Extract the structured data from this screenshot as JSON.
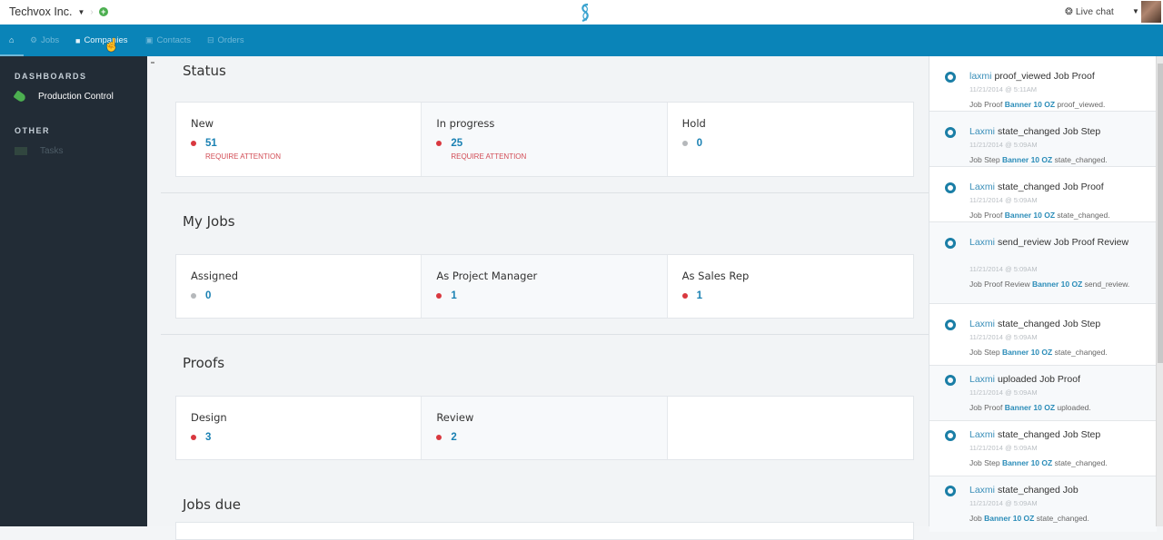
{
  "topbar": {
    "company": "Techvox Inc.",
    "live_chat": "Live chat"
  },
  "nav": {
    "items": [
      {
        "label": "Jobs",
        "icon": "gears-icon"
      },
      {
        "label": "Companies",
        "icon": "building-icon"
      },
      {
        "label": "Contacts",
        "icon": "contacts-icon"
      },
      {
        "label": "Orders",
        "icon": "inbox-icon"
      }
    ]
  },
  "sidebar": {
    "dashboards_heading": "DASHBOARDS",
    "production_control": "Production Control",
    "other_heading": "OTHER",
    "tasks": "Tasks"
  },
  "main": {
    "status": {
      "title": "Status",
      "cards": [
        {
          "label": "New",
          "value": "51",
          "sub": "REQUIRE ATTENTION",
          "dot": "red"
        },
        {
          "label": "In progress",
          "value": "25",
          "sub": "REQUIRE ATTENTION",
          "dot": "red"
        },
        {
          "label": "Hold",
          "value": "0",
          "sub": "",
          "dot": "grey"
        }
      ]
    },
    "my_jobs": {
      "title": "My Jobs",
      "cards": [
        {
          "label": "Assigned",
          "value": "0",
          "dot": "grey"
        },
        {
          "label": "As Project Manager",
          "value": "1",
          "dot": "red"
        },
        {
          "label": "As Sales Rep",
          "value": "1",
          "dot": "red"
        }
      ]
    },
    "proofs": {
      "title": "Proofs",
      "cards": [
        {
          "label": "Design",
          "value": "3",
          "dot": "red"
        },
        {
          "label": "Review",
          "value": "2",
          "dot": "red"
        }
      ]
    },
    "jobs_due": {
      "title": "Jobs due"
    }
  },
  "feed": [
    {
      "user": "laxmi",
      "action": "proof_viewed Job Proof",
      "time": "11/21/2014 @ 5:11AM",
      "pre": "Job Proof",
      "item": "Banner 10 OZ",
      "post": "proof_viewed."
    },
    {
      "user": "Laxmi",
      "action": "state_changed Job Step",
      "time": "11/21/2014 @ 5:09AM",
      "pre": "Job Step",
      "item": "Banner 10 OZ",
      "post": "state_changed."
    },
    {
      "user": "Laxmi",
      "action": "state_changed Job Proof",
      "time": "11/21/2014 @ 5:09AM",
      "pre": "Job Proof",
      "item": "Banner 10 OZ",
      "post": "state_changed."
    },
    {
      "user": "Laxmi",
      "action": "send_review Job Proof Review",
      "time": "11/21/2014 @ 5:09AM",
      "pre": "Job Proof Review",
      "item": "Banner 10 OZ",
      "post": "send_review."
    },
    {
      "user": "Laxmi",
      "action": "state_changed Job Step",
      "time": "11/21/2014 @ 5:09AM",
      "pre": "Job Step",
      "item": "Banner 10 OZ",
      "post": "state_changed."
    },
    {
      "user": "Laxmi",
      "action": "uploaded Job Proof",
      "time": "11/21/2014 @ 5:09AM",
      "pre": "Job Proof",
      "item": "Banner 10 OZ",
      "post": "uploaded."
    },
    {
      "user": "Laxmi",
      "action": "state_changed Job Step",
      "time": "11/21/2014 @ 5:09AM",
      "pre": "Job Step",
      "item": "Banner 10 OZ",
      "post": "state_changed."
    },
    {
      "user": "Laxmi",
      "action": "state_changed Job",
      "time": "11/21/2014 @ 5:09AM",
      "pre": "Job",
      "item": "Banner 10 OZ",
      "post": "state_changed."
    }
  ]
}
